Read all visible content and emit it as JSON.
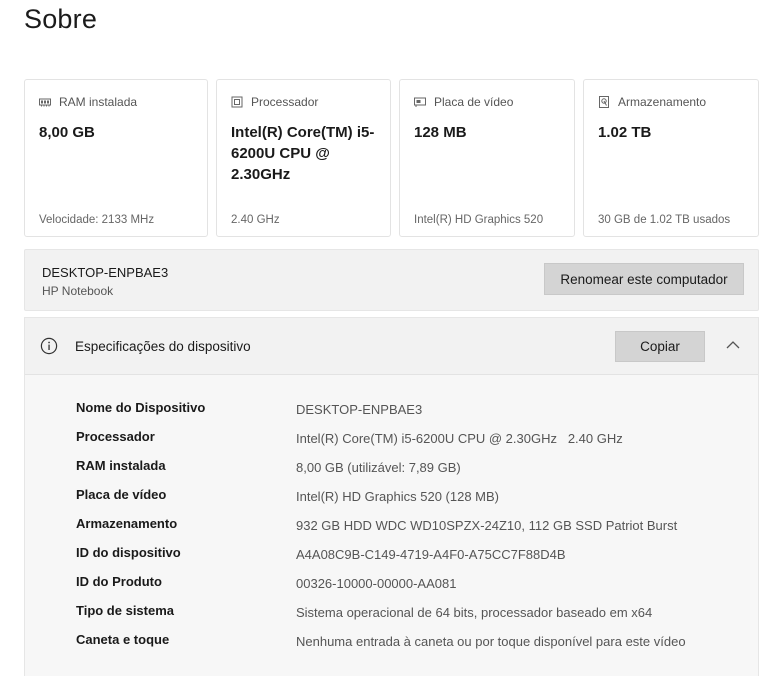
{
  "page": {
    "title": "Sobre"
  },
  "cards": [
    {
      "icon": "ram-icon",
      "label": "RAM instalada",
      "value": "8,00 GB",
      "footer": "Velocidade: 2133 MHz"
    },
    {
      "icon": "processor-icon",
      "label": "Processador",
      "value": "Intel(R) Core(TM) i5-6200U CPU @ 2.30GHz",
      "footer": "2.40 GHz"
    },
    {
      "icon": "gpu-icon",
      "label": "Placa de vídeo",
      "value": "128 MB",
      "footer": "Intel(R) HD Graphics 520"
    },
    {
      "icon": "storage-icon",
      "label": "Armazenamento",
      "value": "1.02 TB",
      "footer": "30 GB de 1.02 TB usados"
    }
  ],
  "computer": {
    "name": "DESKTOP-ENPBAE3",
    "model": "HP Notebook",
    "rename_label": "Renomear este computador"
  },
  "specs": {
    "title": "Especificações do dispositivo",
    "copy_label": "Copiar",
    "rows": [
      {
        "label": "Nome do Dispositivo",
        "value": "DESKTOP-ENPBAE3"
      },
      {
        "label": "Processador",
        "value": "Intel(R) Core(TM) i5-6200U CPU @ 2.30GHz   2.40 GHz"
      },
      {
        "label": "RAM instalada",
        "value": "8,00 GB (utilizável: 7,89 GB)"
      },
      {
        "label": "Placa de vídeo",
        "value": "Intel(R) HD Graphics 520 (128 MB)"
      },
      {
        "label": "Armazenamento",
        "value": "932 GB HDD WDC WD10SPZX-24Z10, 112 GB SSD Patriot Burst"
      },
      {
        "label": "ID do dispositivo",
        "value": "A4A08C9B-C149-4719-A4F0-A75CC7F88D4B"
      },
      {
        "label": "ID do Produto",
        "value": "00326-10000-00000-AA081"
      },
      {
        "label": "Tipo de sistema",
        "value": "Sistema operacional de 64 bits, processador baseado em x64"
      },
      {
        "label": "Caneta e toque",
        "value": "Nenhuma entrada à caneta ou por toque disponível para este vídeo"
      }
    ]
  }
}
